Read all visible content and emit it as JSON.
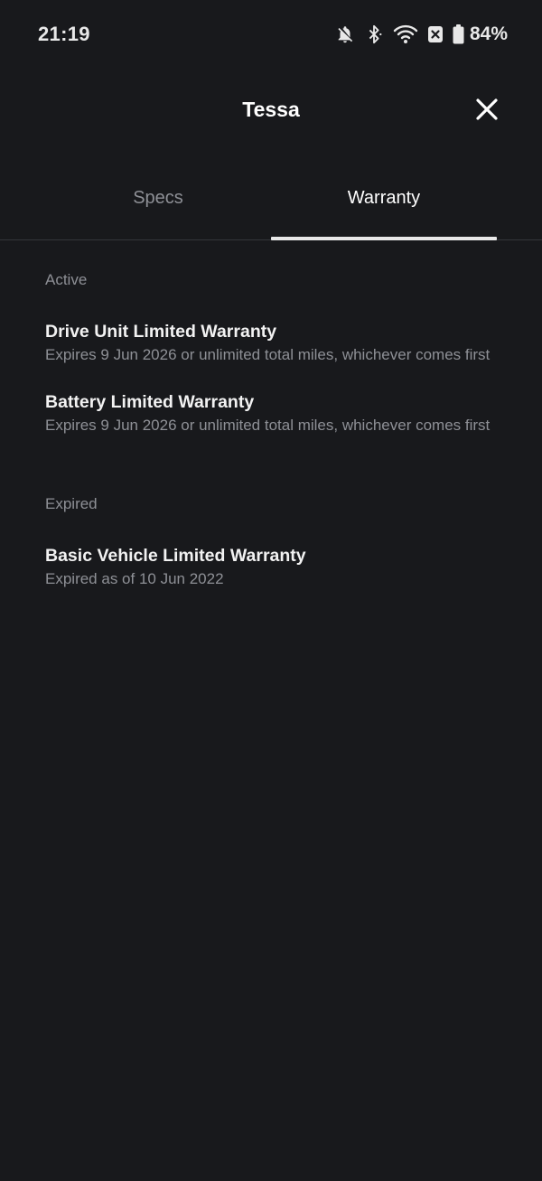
{
  "status_bar": {
    "time": "21:19",
    "battery": "84%",
    "icons": [
      "bell-off-icon",
      "bluetooth-icon",
      "wifi-icon",
      "close-box-icon",
      "battery-icon"
    ]
  },
  "header": {
    "title": "Tessa",
    "close_icon": "close-icon"
  },
  "tabs": [
    {
      "label": "Specs",
      "active": false
    },
    {
      "label": "Warranty",
      "active": true
    }
  ],
  "sections": [
    {
      "label": "Active",
      "items": [
        {
          "title": "Drive Unit Limited Warranty",
          "description": "Expires 9 Jun 2026 or unlimited total miles, whichever comes first"
        },
        {
          "title": "Battery Limited Warranty",
          "description": "Expires 9 Jun 2026 or unlimited total miles, whichever comes first"
        }
      ]
    },
    {
      "label": "Expired",
      "items": [
        {
          "title": "Basic Vehicle Limited Warranty",
          "description": "Expired as of 10 Jun 2022"
        }
      ]
    }
  ],
  "colors": {
    "background": "#18191c",
    "primary_text": "#ffffff",
    "secondary_text": "#8e9096",
    "tab_indicator": "#e8e8e8"
  }
}
